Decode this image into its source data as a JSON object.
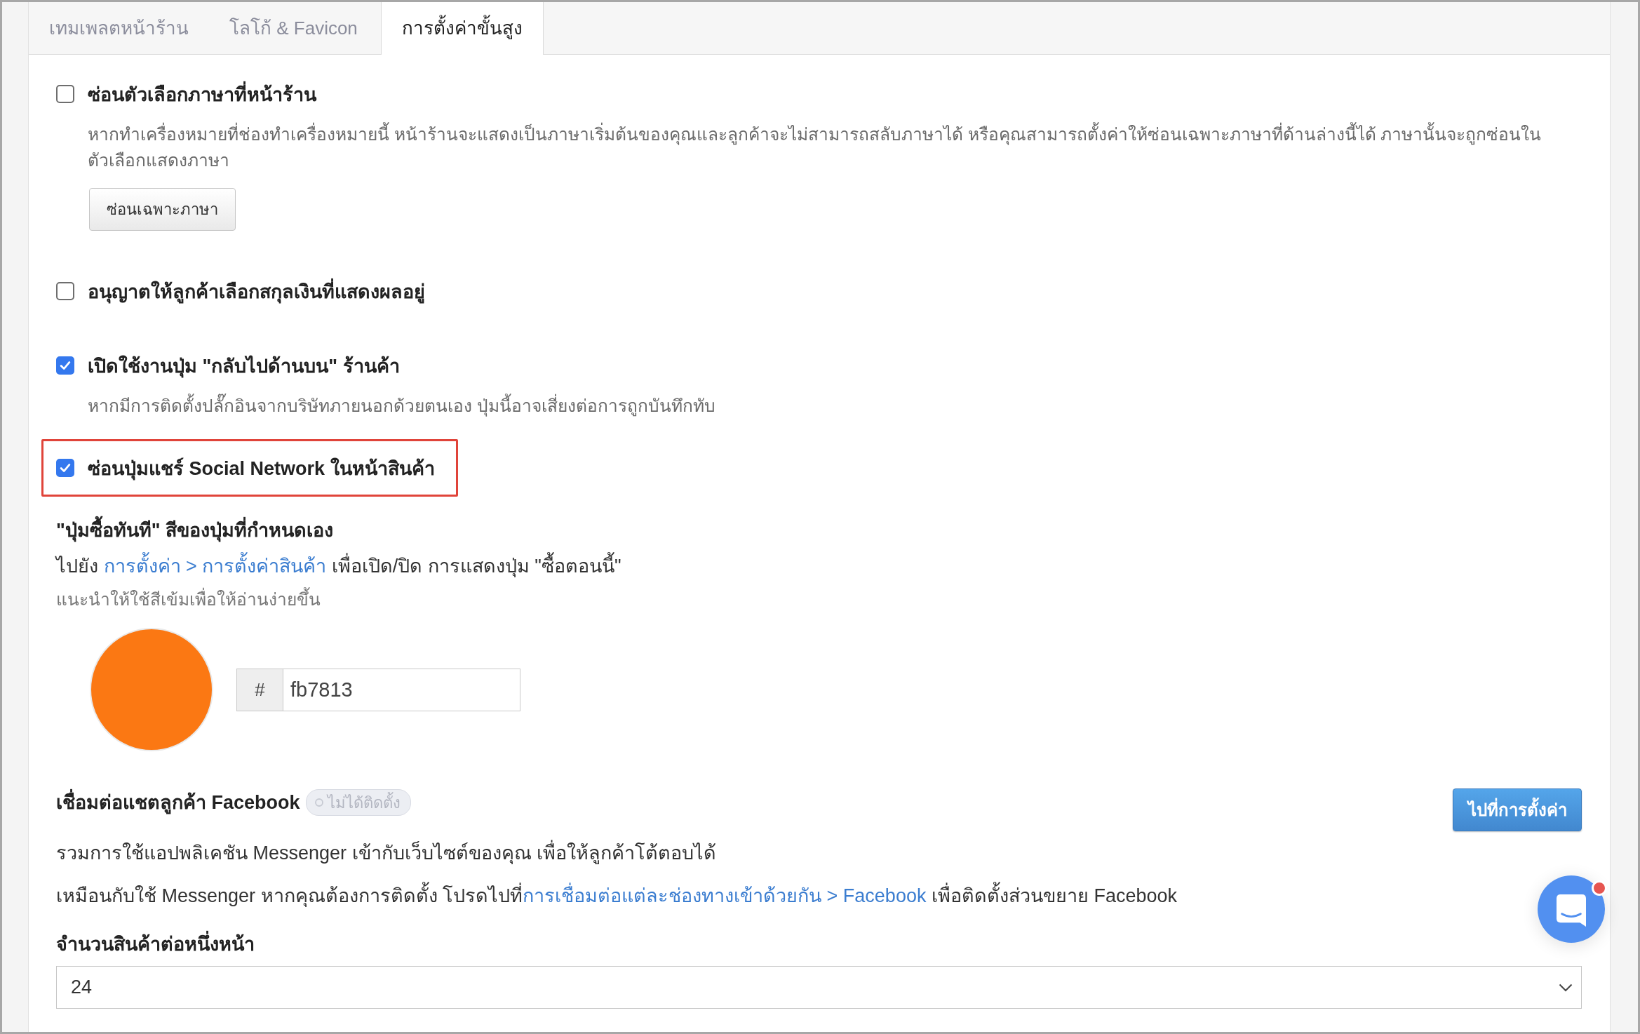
{
  "tabs": [
    {
      "label": "เทมเพลตหน้าร้าน",
      "selected": false
    },
    {
      "label": "โลโก้ & Favicon",
      "selected": false
    },
    {
      "label": "การตั้งค่าขั้นสูง",
      "selected": true
    }
  ],
  "options": [
    {
      "label": "ซ่อนตัวเลือกภาษาที่หน้าร้าน",
      "checked": false,
      "highlighted": false,
      "description": "หากทำเครื่องหมายที่ช่องทำเครื่องหมายนี้ หน้าร้านจะแสดงเป็นภาษาเริ่มต้นของคุณและลูกค้าจะไม่สามารถสลับภาษาได้ หรือคุณสามารถตั้งค่าให้ซ่อนเฉพาะภาษาที่ด้านล่างนี้ได้ ภาษานั้นจะถูกซ่อนในตัวเลือกแสดงภาษา",
      "button": "ซ่อนเฉพาะภาษา"
    },
    {
      "label": "อนุญาตให้ลูกค้าเลือกสกุลเงินที่แสดงผลอยู่",
      "checked": false,
      "highlighted": false
    },
    {
      "label": "เปิดใช้งานปุ่ม \"กลับไปด้านบน\" ร้านค้า",
      "checked": true,
      "highlighted": false,
      "description": "หากมีการติดตั้งปลั๊กอินจากบริษัทภายนอกด้วยตนเอง ปุ่มนี้อาจเสี่ยงต่อการถูกบันทึกทับ"
    },
    {
      "label": "ซ่อนปุ่มแชร์ Social Network ในหน้าสินค้า",
      "checked": true,
      "highlighted": true
    }
  ],
  "buy_now_color": {
    "heading": "\"ปุ่มซื้อทันที\" สีของปุ่มที่กำหนดเอง",
    "instruction": {
      "before": "ไปยัง ",
      "link": "การตั้งค่า > การตั้งค่าสินค้า",
      "after": " เพื่อเปิด/ปิด การแสดงปุ่ม \"ซื้อตอนนี้\""
    },
    "hint": "แนะนำให้ใช้สีเข้มเพื่อให้อ่านง่ายขึ้น",
    "prefix": "#",
    "value": "fb7813"
  },
  "facebook_chat": {
    "title": "เชื่อมต่อแชตลูกค้า Facebook",
    "status": "ไม่ได้ติดตั้ง",
    "installed": false,
    "button": "ไปที่การตั้งค่า",
    "description": "รวมการใช้แอปพลิเคชัน Messenger เข้ากับเว็บไซต์ของคุณ เพื่อให้ลูกค้าโต้ตอบได้",
    "instruction": {
      "before": "เหมือนกับใช้ Messenger หากคุณต้องการติดตั้ง โปรดไปที่",
      "link": "การเชื่อมต่อแต่ละช่องทางเข้าด้วยกัน > Facebook",
      "after": " เพื่อติดตั้งส่วนขยาย Facebook"
    }
  },
  "products_per_page": {
    "label": "จำนวนสินค้าต่อหนึ่งหน้า",
    "value": "24"
  },
  "chat_launcher": {
    "unread": true
  }
}
